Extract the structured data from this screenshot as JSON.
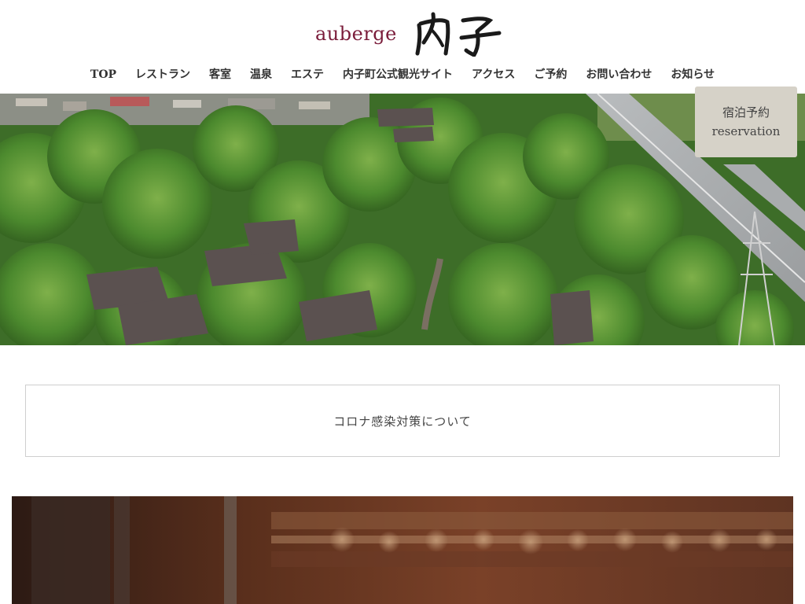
{
  "header": {
    "logo_text": "auberge",
    "logo_mark": "内子"
  },
  "nav": {
    "items": [
      {
        "label": "TOP"
      },
      {
        "label": "レストラン"
      },
      {
        "label": "客室"
      },
      {
        "label": "温泉"
      },
      {
        "label": "エステ"
      },
      {
        "label": "内子町公式観光サイト"
      },
      {
        "label": "アクセス"
      },
      {
        "label": "ご予約"
      },
      {
        "label": "お問い合わせ"
      },
      {
        "label": "お知らせ"
      }
    ]
  },
  "reservation": {
    "label_ja": "宿泊予約",
    "label_en": "reservation"
  },
  "notice": {
    "text": "コロナ感染対策について"
  },
  "colors": {
    "brand": "#7a1c3a",
    "reserve_bg": "#d6d2c8"
  }
}
